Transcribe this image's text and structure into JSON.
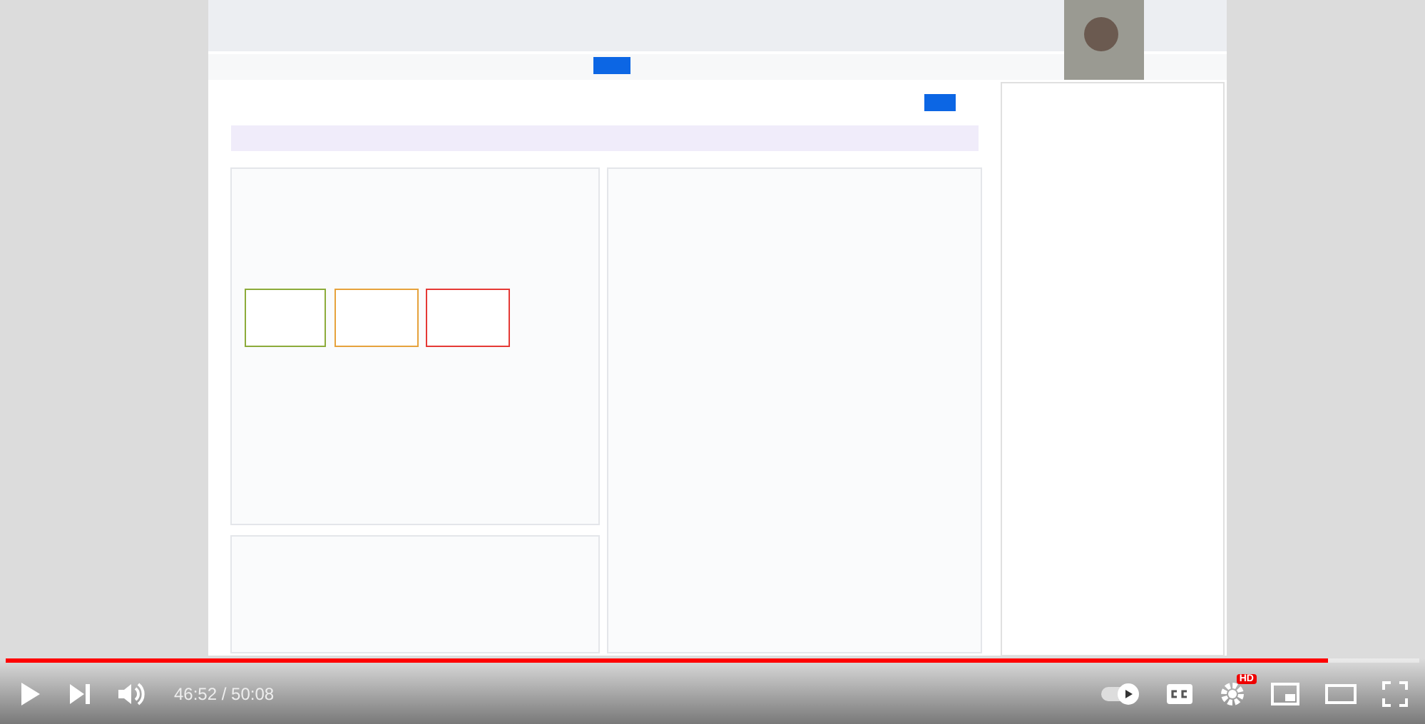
{
  "player": {
    "progress": {
      "level": 0.935
    },
    "time": "46:52 / 50:08",
    "autoplay": {
      "on": true
    },
    "captions": {
      "on": false
    },
    "quality_badge": "HD"
  }
}
